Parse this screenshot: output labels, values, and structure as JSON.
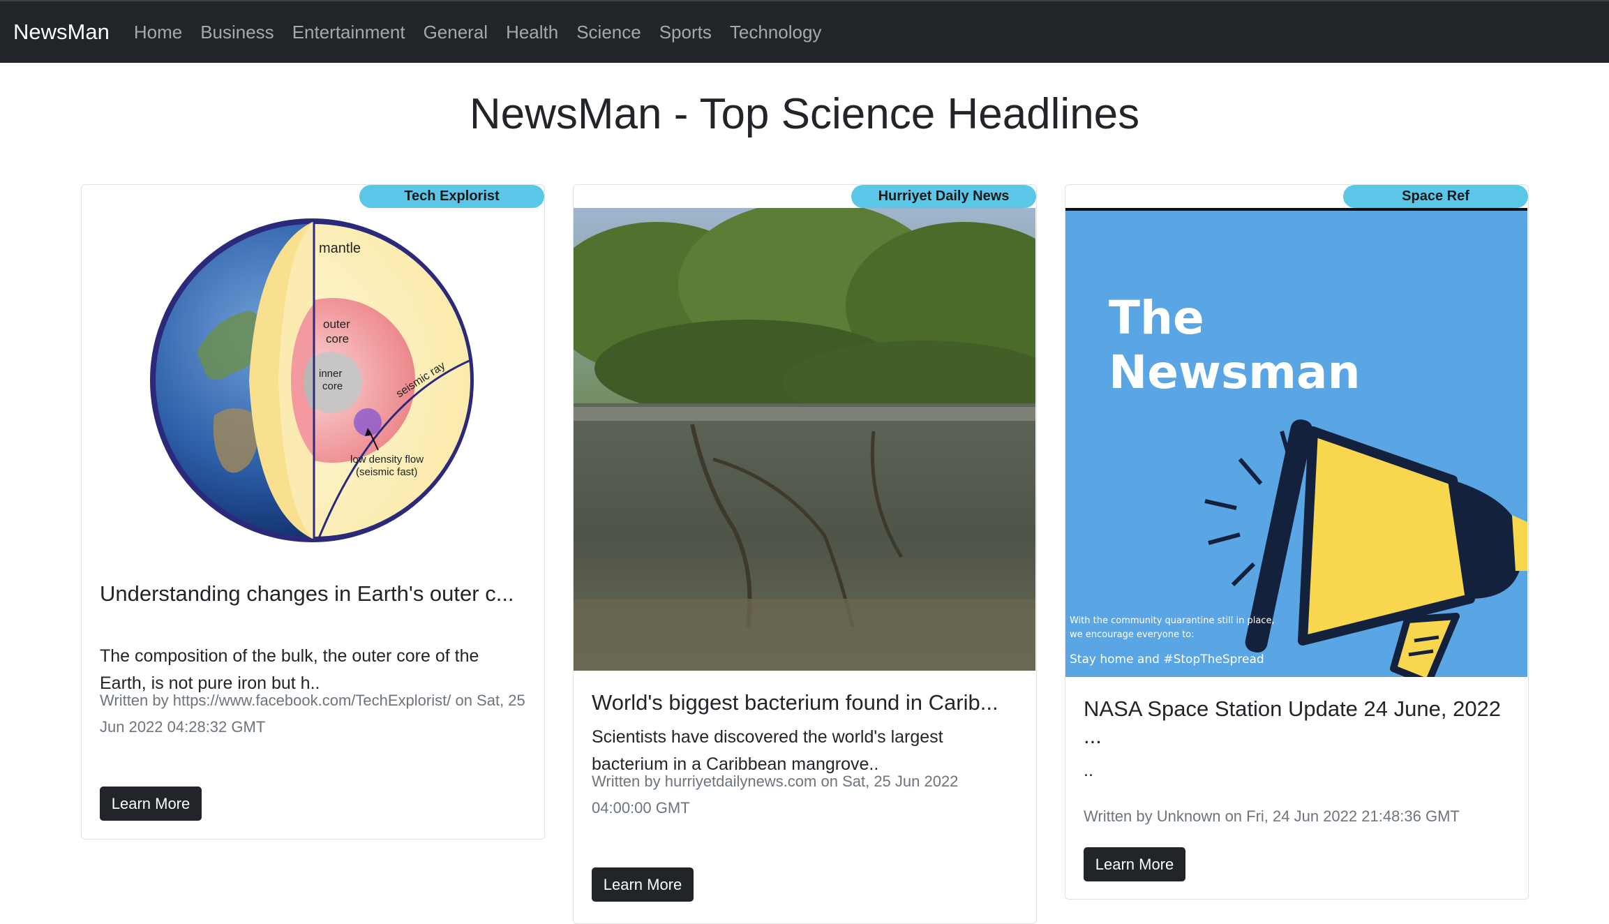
{
  "nav": {
    "brand": "NewsMan",
    "links": [
      "Home",
      "Business",
      "Entertainment",
      "General",
      "Health",
      "Science",
      "Sports",
      "Technology"
    ]
  },
  "page_title": "NewsMan - Top Science Headlines",
  "cards": [
    {
      "source": "Tech Explorist",
      "title": "Understanding changes in Earth's outer c...",
      "description": "The composition of the bulk, the outer core of the Earth, is not pure iron but h..",
      "meta": "Written by https://www.facebook.com/TechExplorist/ on Sat, 25 Jun 2022 04:28:32 GMT",
      "button": "Learn More",
      "image_labels": {
        "mantle": "mantle",
        "outer_core_1": "outer",
        "outer_core_2": "core",
        "inner_core_1": "inner",
        "inner_core_2": "core",
        "seismic": "seismic ray",
        "flow_1": "low density flow",
        "flow_2": "(seismic fast)"
      }
    },
    {
      "source": "Hurriyet Daily News",
      "title": "World's biggest bacterium found in Carib...",
      "description": "Scientists have discovered the world's largest bacterium in a Caribbean mangrove..",
      "meta": "Written by hurriyetdailynews.com on Sat, 25 Jun 2022 04:00:00 GMT",
      "button": "Learn More"
    },
    {
      "source": "Space Ref",
      "title": "NASA Space Station Update 24 June, 2022 ...",
      "description": "..",
      "meta": "Written by Unknown on Fri, 24 Jun 2022 21:48:36 GMT",
      "button": "Learn More",
      "image_labels": {
        "headline_1": "The",
        "headline_2": "Newsman",
        "small_1": "With the community quarantine still in place,",
        "small_2": "we encourage everyone to:",
        "small_3": "Stay home and #StopTheSpread"
      }
    }
  ],
  "colors": {
    "navbar": "#212529",
    "badge": "#5bc7e8",
    "button": "#212529",
    "poster_bg": "#5aa5e3",
    "megaphone": "#f8d64e"
  }
}
